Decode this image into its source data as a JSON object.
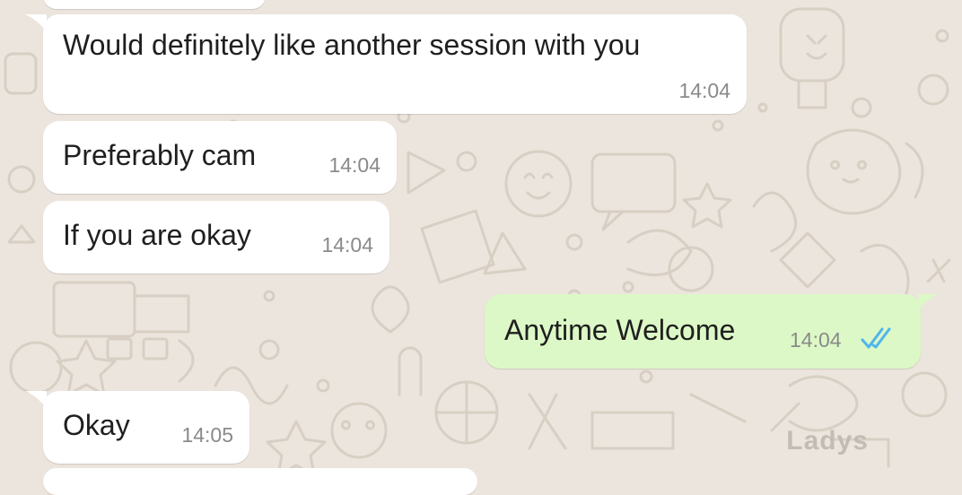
{
  "chat": {
    "messages": [
      {
        "id": 1,
        "text": "",
        "time": "",
        "direction": "incoming"
      },
      {
        "id": 2,
        "text": "Would definitely like another session with you",
        "time": "14:04",
        "direction": "incoming"
      },
      {
        "id": 3,
        "text": "Preferably cam",
        "time": "14:04",
        "direction": "incoming"
      },
      {
        "id": 4,
        "text": "If you are okay",
        "time": "14:04",
        "direction": "incoming"
      },
      {
        "id": 5,
        "text": "Anytime Welcome",
        "time": "14:04",
        "direction": "outgoing",
        "status": "read"
      },
      {
        "id": 6,
        "text": "Okay",
        "time": "14:05",
        "direction": "incoming"
      }
    ]
  },
  "watermark": "Ladys",
  "colors": {
    "background": "#ece5dd",
    "incoming_bubble": "#ffffff",
    "outgoing_bubble": "#dcf8c6",
    "read_ticks": "#4fb6ec",
    "time_text": "#8a8a8a"
  },
  "icons": {
    "read_status": "double-check-icon"
  }
}
